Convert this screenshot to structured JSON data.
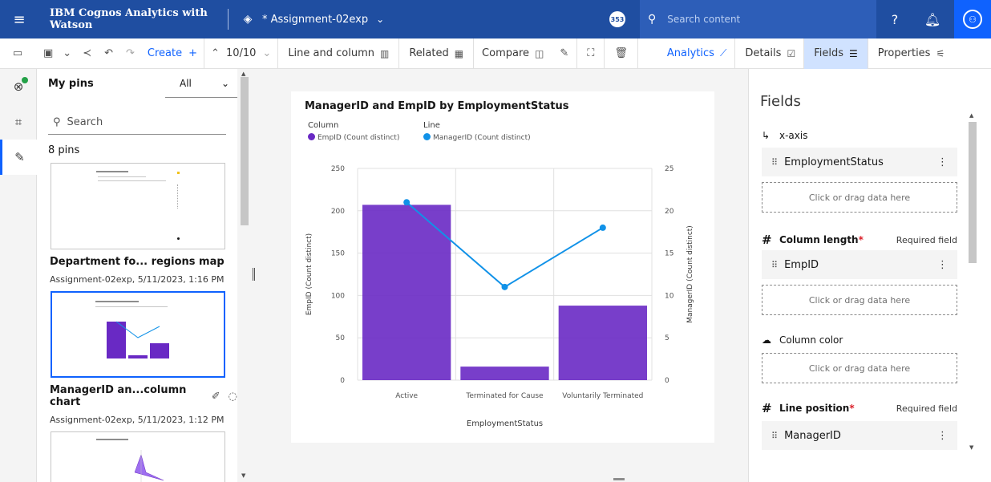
{
  "topbar": {
    "app_name": "IBM Cognos Analytics with Watson",
    "asset_name": "* Assignment-02exp",
    "notification_badge": "353",
    "search_placeholder": "Search content"
  },
  "toolbar": {
    "create_label": "Create",
    "page_indicator": "10/10",
    "visualization_type": "Line and column",
    "related_label": "Related",
    "compare_label": "Compare",
    "analytics_label": "Analytics",
    "details_label": "Details",
    "fields_label": "Fields",
    "properties_label": "Properties",
    "active_tab": "Fields"
  },
  "pins_panel": {
    "title": "My pins",
    "filter_value": "All",
    "search_placeholder": "Search",
    "count_text": "8 pins",
    "pins": [
      {
        "title": "Department fo... regions map",
        "meta": "Assignment-02exp, 5/11/2023, 1:16 PM",
        "selected": false
      },
      {
        "title": "ManagerID an...column chart",
        "meta": "Assignment-02exp, 5/11/2023, 1:12 PM",
        "selected": true
      }
    ]
  },
  "chart_data": {
    "type": "bar",
    "title": "ManagerID and EmpID by EmploymentStatus",
    "legend_headers": {
      "column": "Column",
      "line": "Line"
    },
    "categories": [
      "Active",
      "Terminated for Cause",
      "Voluntarily Terminated"
    ],
    "series": [
      {
        "name": "EmpID (Count distinct)",
        "kind": "column",
        "axis": "left",
        "color": "#6929c4",
        "values": [
          207,
          16,
          88
        ]
      },
      {
        "name": "ManagerID (Count distinct)",
        "kind": "line",
        "axis": "right",
        "color": "#1192e8",
        "values": [
          21,
          11,
          18
        ]
      }
    ],
    "xlabel": "EmploymentStatus",
    "ylabel": "EmpID (Count distinct)",
    "y2label": "ManagerID (Count distinct)",
    "ylim": [
      0,
      250
    ],
    "y2lim": [
      0,
      25
    ],
    "yticks": [
      "0",
      "50",
      "100",
      "150",
      "200",
      "250"
    ],
    "y2ticks": [
      "0",
      "5",
      "10",
      "15",
      "20",
      "25"
    ],
    "grid": true
  },
  "fields_panel": {
    "title": "Fields",
    "xaxis_label": "x-axis",
    "xaxis_field": "EmploymentStatus",
    "column_length_label": "Column length",
    "column_length_field": "EmpID",
    "column_color_label": "Column color",
    "line_position_label": "Line position",
    "line_position_field": "ManagerID",
    "required_marker": "*",
    "required_text": "Required field",
    "drop_text": "Click or drag data here"
  }
}
